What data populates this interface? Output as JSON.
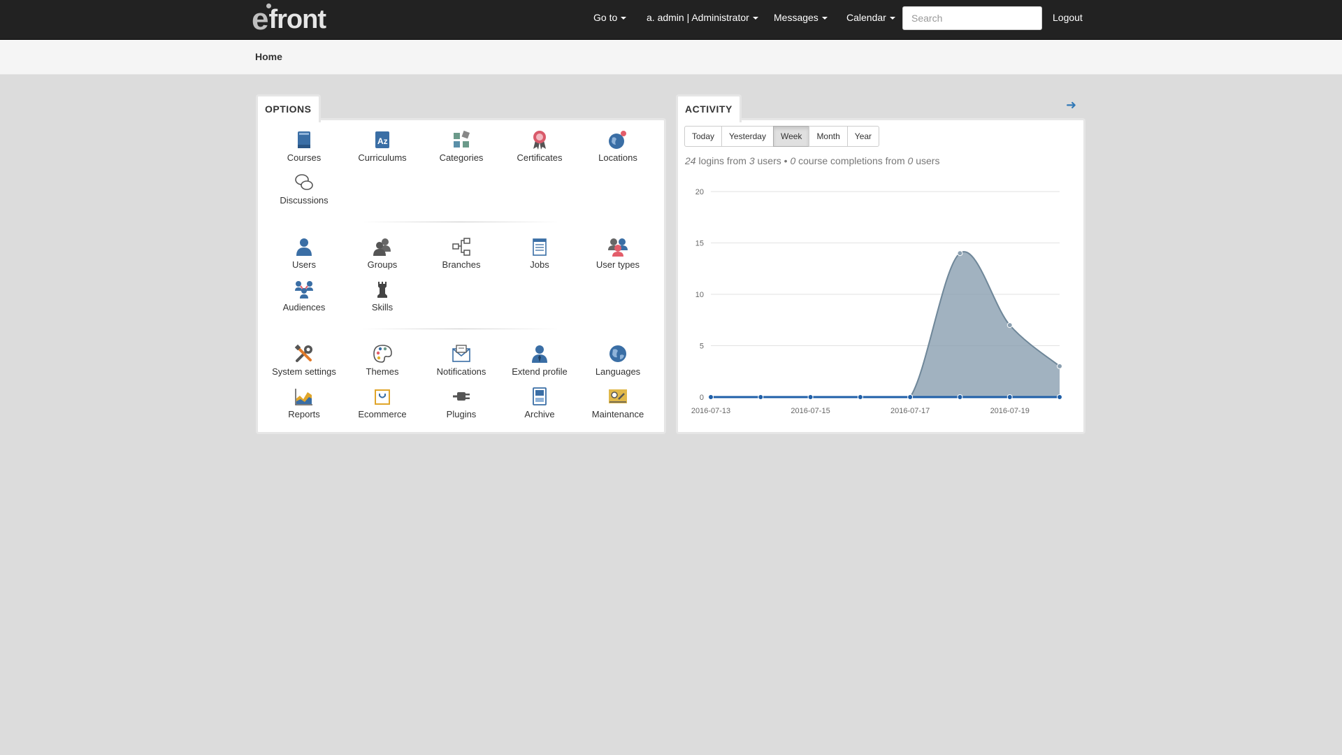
{
  "navbar": {
    "logo_text": "front",
    "logo_letter": "e",
    "goto": "Go to",
    "user": "a. admin | Administrator",
    "messages": "Messages",
    "calendar": "Calendar",
    "search_placeholder": "Search",
    "logout": "Logout"
  },
  "breadcrumb": {
    "home": "Home"
  },
  "options": {
    "title": "OPTIONS",
    "groups": [
      [
        {
          "label": "Courses",
          "icon": "book-icon"
        },
        {
          "label": "Curriculums",
          "icon": "az-book-icon"
        },
        {
          "label": "Categories",
          "icon": "categories-icon"
        },
        {
          "label": "Certificates",
          "icon": "certificate-icon"
        },
        {
          "label": "Locations",
          "icon": "globe-pin-icon"
        },
        {
          "label": "Discussions",
          "icon": "chat-bubbles-icon"
        }
      ],
      [
        {
          "label": "Users",
          "icon": "user-icon"
        },
        {
          "label": "Groups",
          "icon": "group-icon"
        },
        {
          "label": "Branches",
          "icon": "branches-icon"
        },
        {
          "label": "Jobs",
          "icon": "notepad-icon"
        },
        {
          "label": "User types",
          "icon": "user-types-icon"
        },
        {
          "label": "Audiences",
          "icon": "audiences-icon"
        },
        {
          "label": "Skills",
          "icon": "chess-rook-icon"
        }
      ],
      [
        {
          "label": "System settings",
          "icon": "tools-icon"
        },
        {
          "label": "Themes",
          "icon": "palette-icon"
        },
        {
          "label": "Notifications",
          "icon": "envelope-icon"
        },
        {
          "label": "Extend profile",
          "icon": "user-tie-icon"
        },
        {
          "label": "Languages",
          "icon": "globe-icon"
        },
        {
          "label": "Reports",
          "icon": "area-chart-icon"
        },
        {
          "label": "Ecommerce",
          "icon": "shopping-bag-icon"
        },
        {
          "label": "Plugins",
          "icon": "plug-icon"
        },
        {
          "label": "Archive",
          "icon": "archive-icon"
        },
        {
          "label": "Maintenance",
          "icon": "maintenance-icon"
        }
      ]
    ]
  },
  "activity": {
    "title": "ACTIVITY",
    "buttons": [
      "Today",
      "Yesterday",
      "Week",
      "Month",
      "Year"
    ],
    "active_button": "Week",
    "summary": {
      "logins": "24",
      "logins_text": " logins from ",
      "users": "3",
      "users_text": " users • ",
      "completions": "0",
      "completions_text": " course completions from ",
      "completion_users": "0",
      "end_text": " users"
    }
  },
  "chart_data": {
    "type": "area",
    "x": [
      "2016-07-13",
      "2016-07-14",
      "2016-07-15",
      "2016-07-16",
      "2016-07-17",
      "2016-07-18",
      "2016-07-19",
      "2016-07-20"
    ],
    "x_tick_labels": [
      "2016-07-13",
      "2016-07-15",
      "2016-07-17",
      "2016-07-19"
    ],
    "series": [
      {
        "values": [
          0,
          0,
          0,
          0,
          0,
          14,
          7,
          3
        ],
        "color": "#8a9fb0"
      },
      {
        "values": [
          0,
          0,
          0,
          0,
          0,
          0,
          0,
          0
        ],
        "color": "#1f5fa8"
      }
    ],
    "ylim": [
      0,
      20
    ],
    "y_ticks": [
      0,
      5,
      10,
      15,
      20
    ],
    "grid": true
  }
}
